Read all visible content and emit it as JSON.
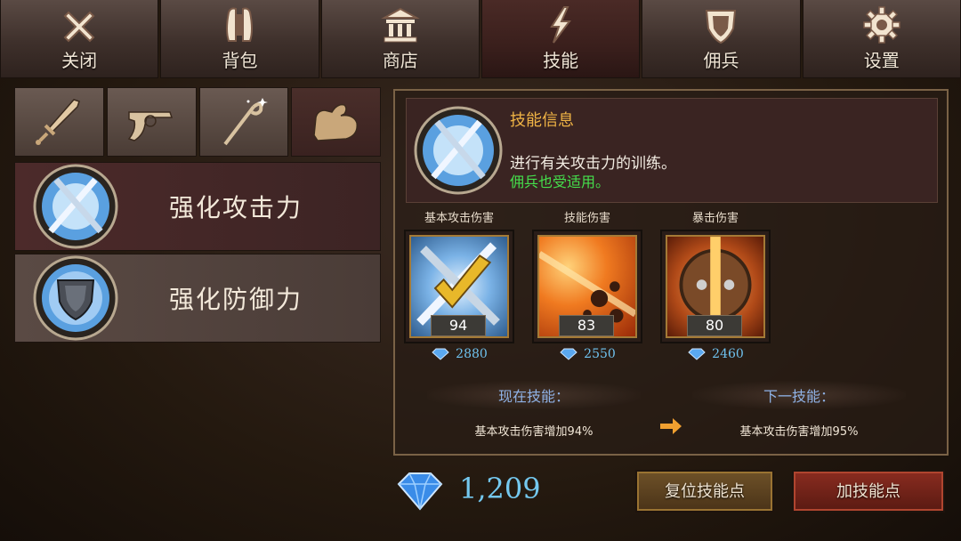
{
  "tabs": [
    {
      "label": "关闭",
      "icon": "close-icon"
    },
    {
      "label": "背包",
      "icon": "backpack-icon"
    },
    {
      "label": "商店",
      "icon": "shop-icon"
    },
    {
      "label": "技能",
      "icon": "lightning-icon",
      "active": true
    },
    {
      "label": "佣兵",
      "icon": "shield-icon"
    },
    {
      "label": "设置",
      "icon": "gear-icon"
    }
  ],
  "categories": [
    {
      "icon": "sword-icon"
    },
    {
      "icon": "revolver-icon"
    },
    {
      "icon": "staff-icon"
    },
    {
      "icon": "bicep-icon",
      "active": true
    }
  ],
  "skills": [
    {
      "name": "强化攻击力",
      "icon": "crossed-blades-icon",
      "selected": true
    },
    {
      "name": "强化防御力",
      "icon": "defense-shield-icon",
      "selected": false
    }
  ],
  "info": {
    "title": "技能信息",
    "description": "进行有关攻击力的训练。",
    "note": "佣兵也受适用。"
  },
  "cards": [
    {
      "label": "基本攻击伤害",
      "level": "94",
      "cost": "2880",
      "icon": "checkmark-blades-icon"
    },
    {
      "label": "技能伤害",
      "level": "83",
      "cost": "2550",
      "icon": "fire-burst-icon"
    },
    {
      "label": "暴击伤害",
      "level": "80",
      "cost": "2460",
      "icon": "split-shield-icon"
    }
  ],
  "current": {
    "label": "现在技能：",
    "value": "基本攻击伤害增加94%"
  },
  "next": {
    "label": "下一技能：",
    "value": "基本攻击伤害增加95%"
  },
  "gems_total": "1,209",
  "buttons": {
    "reset": "复位技能点",
    "add": "加技能点"
  },
  "colors": {
    "accent_gold": "#f0b445",
    "note_green": "#45e04c",
    "gem_blue": "#74c8ef",
    "add_red": "#8a2c20"
  }
}
